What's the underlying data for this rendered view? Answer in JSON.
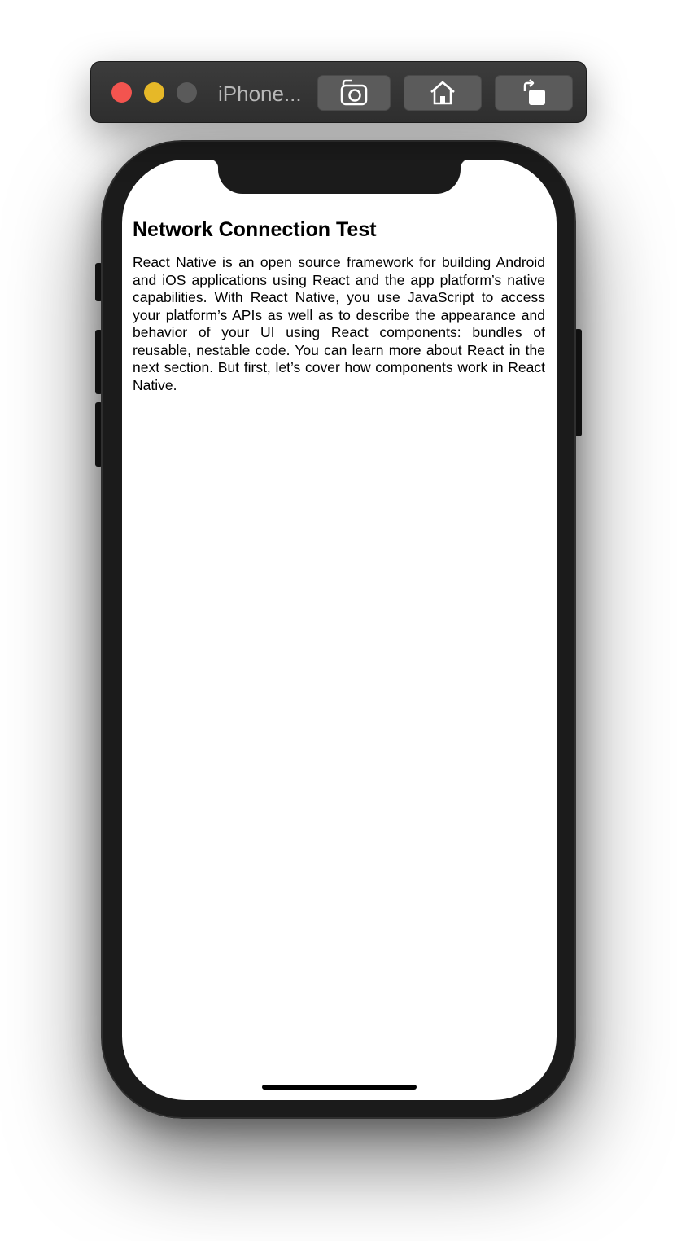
{
  "window": {
    "device_name": "iPhone...",
    "traffic_lights": {
      "close_color": "#f3544f",
      "minimize_color": "#e6b828",
      "zoom_color": "#5a5a5a"
    },
    "toolbar_buttons": [
      {
        "name": "screenshot",
        "icon": "camera-icon"
      },
      {
        "name": "home",
        "icon": "home-icon"
      },
      {
        "name": "rotate",
        "icon": "rotate-icon"
      }
    ]
  },
  "app": {
    "title": "Network Connection Test",
    "body": "React Native is an open source framework for building Android and iOS applications using React and the app platform’s native capabilities. With React Native, you use JavaScript to access your platform’s APIs as well as to describe the appearance and behavior of your UI using React components: bundles of reusable, nestable code. You can learn more about React in the next section. But first, let’s cover how components work in React Native."
  }
}
